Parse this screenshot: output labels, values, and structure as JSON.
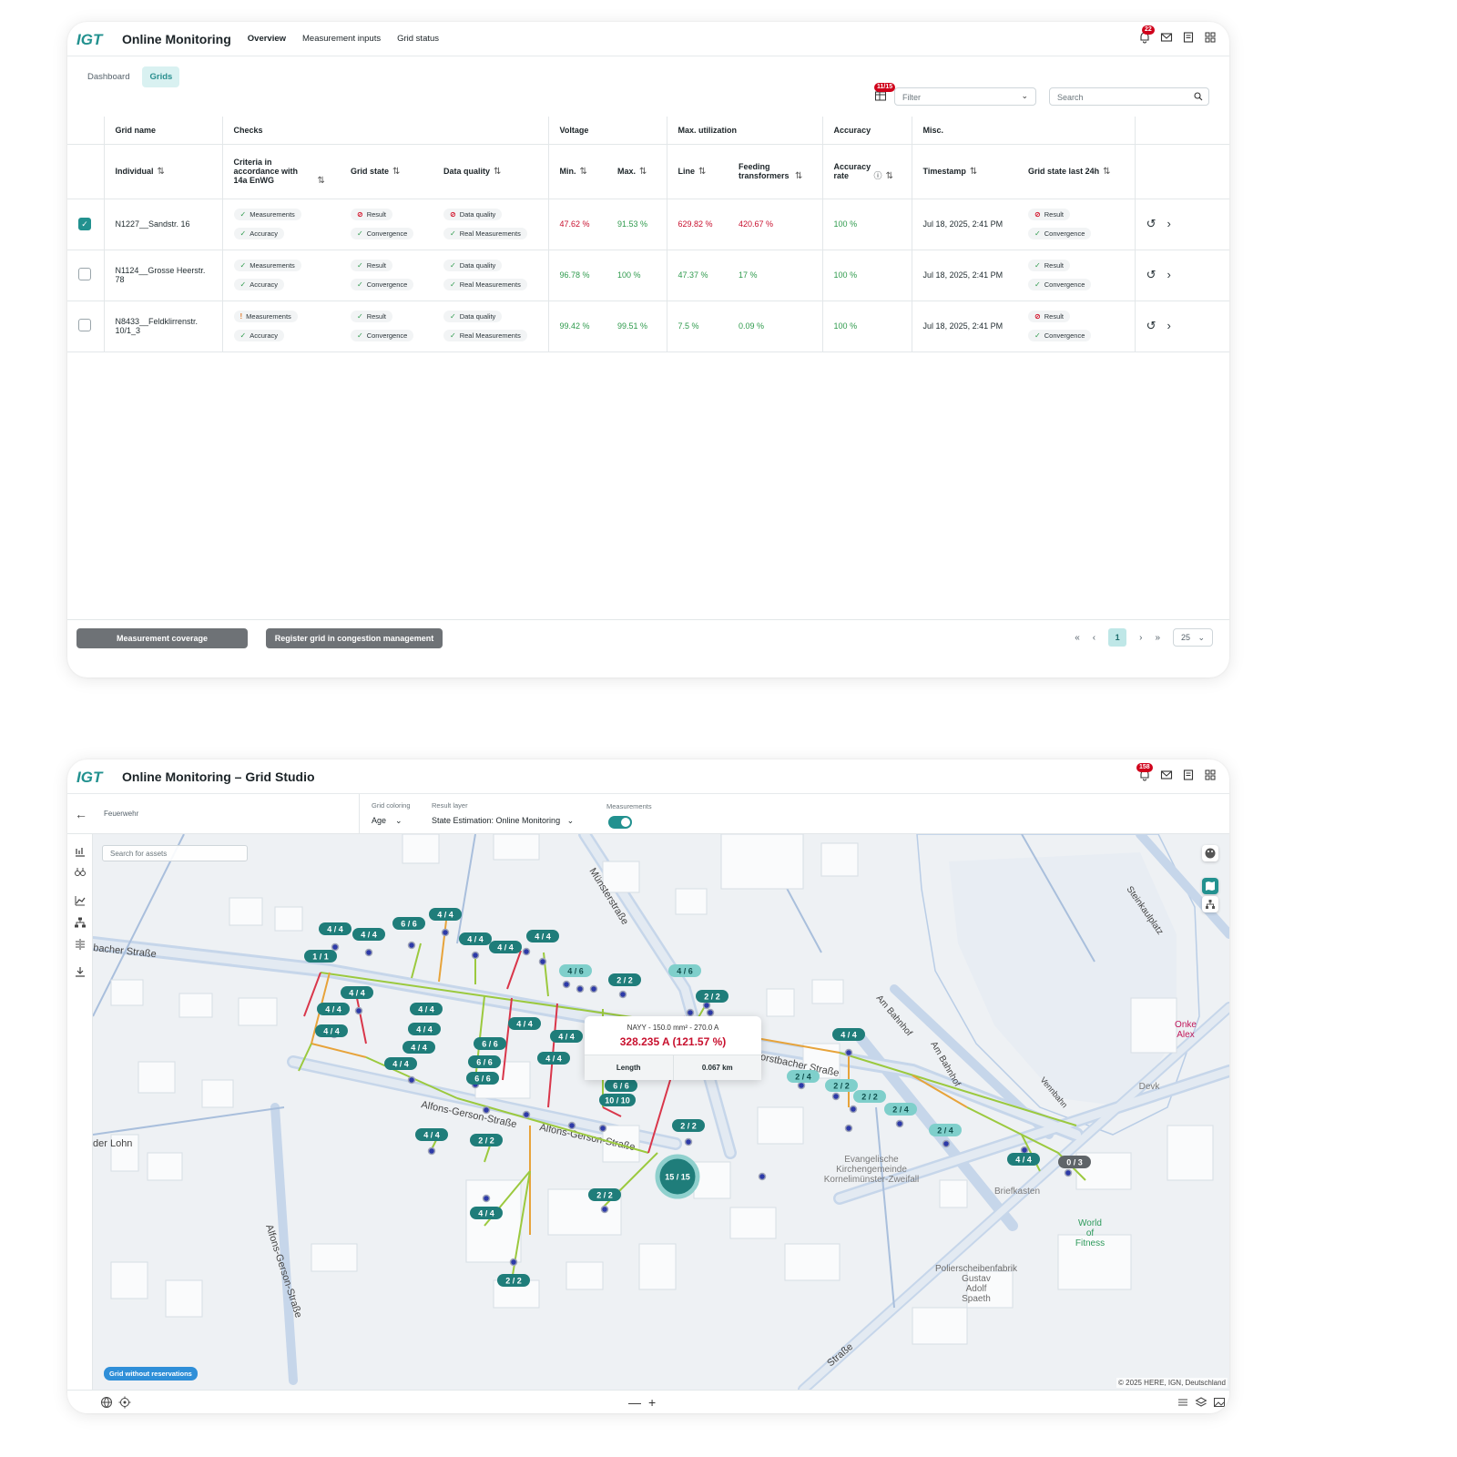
{
  "brand": {
    "accent": "#22918f",
    "alert": "#d0021b",
    "ok": "#2e9a4c",
    "logo_text": "IGT"
  },
  "screen1": {
    "app_title": "Online Monitoring",
    "nav": [
      "Overview",
      "Measurement inputs",
      "Grid status"
    ],
    "notification_count": "22",
    "tabs": [
      "Dashboard",
      "Grids"
    ],
    "column_selector_count": "11/15",
    "filter_placeholder": "Filter",
    "search_placeholder": "Search",
    "groups": [
      "Grid name",
      "Checks",
      "Voltage",
      "Max. utilization",
      "Accuracy",
      "Misc."
    ],
    "columns": {
      "individual": "Individual",
      "criteria": "Criteria in accordance with 14a EnWG",
      "grid_state": "Grid state",
      "data_quality": "Data quality",
      "min": "Min.",
      "max": "Max.",
      "line": "Line",
      "feeding": "Feeding transformers",
      "accuracy_rate": "Accuracy rate",
      "timestamp": "Timestamp",
      "grid_state_24h": "Grid state last 24h"
    },
    "rows": [
      {
        "checked": true,
        "name": "N1227__Sandstr. 16",
        "c1": "Measurements",
        "c1s": "ok",
        "c2": "Accuracy",
        "c2s": "ok",
        "g1": "Result",
        "g1s": "bad",
        "g2": "Convergence",
        "g2s": "ok",
        "d1": "Data quality",
        "d1s": "bad",
        "d2": "Real Measurements",
        "d2s": "ok",
        "min": "47.62 %",
        "max": "91.53 %",
        "line": "629.82 %",
        "feed": "420.67 %",
        "acc": "100 %",
        "ts": "Jul 18, 2025, 2:41 PM",
        "h1": "Result",
        "h1s": "bad",
        "h2": "Convergence",
        "h2s": "ok"
      },
      {
        "checked": false,
        "name": "N1124__Grosse Heerstr. 78",
        "c1": "Measurements",
        "c1s": "ok",
        "c2": "Accuracy",
        "c2s": "ok",
        "g1": "Result",
        "g1s": "ok",
        "g2": "Convergence",
        "g2s": "ok",
        "d1": "Data quality",
        "d1s": "ok",
        "d2": "Real Measurements",
        "d2s": "ok",
        "min": "96.78 %",
        "max": "100 %",
        "line": "47.37 %",
        "feed": "17 %",
        "acc": "100 %",
        "ts": "Jul 18, 2025, 2:41 PM",
        "h1": "Result",
        "h1s": "ok",
        "h2": "Convergence",
        "h2s": "ok"
      },
      {
        "checked": false,
        "name": "N8433__Feldklirrenstr. 10/1_3",
        "c1": "Measurements",
        "c1s": "warn",
        "c2": "Accuracy",
        "c2s": "ok",
        "g1": "Result",
        "g1s": "ok",
        "g2": "Convergence",
        "g2s": "ok",
        "d1": "Data quality",
        "d1s": "ok",
        "d2": "Real Measurements",
        "d2s": "ok",
        "min": "99.42 %",
        "max": "99.51 %",
        "line": "7.5 %",
        "feed": "0.09 %",
        "acc": "100 %",
        "ts": "Jul 18, 2025, 2:41 PM",
        "h1": "Result",
        "h1s": "bad",
        "h2": "Convergence",
        "h2s": "ok"
      }
    ],
    "buttons": {
      "coverage": "Measurement coverage",
      "register": "Register grid in congestion management"
    },
    "pager": {
      "first": "«",
      "prev": "‹",
      "page": "1",
      "next": "›",
      "last": "»",
      "size": "25"
    }
  },
  "screen2": {
    "app_title": "Online Monitoring – Grid Studio",
    "notification_count": "158",
    "breadcrumb": "Feuerwehr",
    "grid_coloring_label": "Grid coloring",
    "grid_coloring_value": "Age",
    "result_layer_label": "Result layer",
    "result_layer_value": "State Estimation: Online Monitoring",
    "measurements_label": "Measurements",
    "measurements_on": true,
    "asset_search_placeholder": "Search for assets",
    "tooltip": {
      "cable": "NAYY - 150.0 mm² - 270.0 A",
      "value": "328.235 A (121.57 %)",
      "length_label": "Length",
      "length_value": "0.067 km"
    },
    "legend_chip": "Grid without reservations",
    "copyright": "© 2025 HERE, IGN, Deutschland",
    "streets": [
      "bacher Straße",
      "Münsterstraße",
      "Alfons-Gerson-Straße",
      "Alfons-Gerson-Straße",
      "Alfons-Gerson-Straße",
      "Am Bahnhof",
      "Am Bahnhof",
      "Steinkaulplatz",
      "erforstbacher Straße",
      "der Lohn",
      "Vennbahn",
      "Straße"
    ],
    "pois": [
      "Evangelische Kirchengemeinde Kornelimünster-Zweifall",
      "Briefkasten",
      "World of Fitness",
      "Polierscheibenfabrik Gustav Adolf Spaeth",
      "Devk",
      "Onke Alex"
    ],
    "clusters": [
      {
        "label": "4 / 4"
      },
      {
        "label": "4 / 4"
      },
      {
        "label": "1 / 1"
      },
      {
        "label": "6 / 6"
      },
      {
        "label": "4 / 4"
      },
      {
        "label": "4 / 4"
      },
      {
        "label": "4 / 4"
      },
      {
        "label": "4 / 4"
      },
      {
        "label": "4 / 6"
      },
      {
        "label": "2 / 2"
      },
      {
        "label": "4 / 6"
      },
      {
        "label": "2 / 2"
      },
      {
        "label": "4 / 4"
      },
      {
        "label": "4 / 4"
      },
      {
        "label": "4 / 4"
      },
      {
        "label": "4 / 4"
      },
      {
        "label": "4 / 4"
      },
      {
        "label": "4 / 4"
      },
      {
        "label": "4 / 4"
      },
      {
        "label": "6 / 6"
      },
      {
        "label": "6 / 6"
      },
      {
        "label": "6 / 6"
      },
      {
        "label": "4 / 4"
      },
      {
        "label": "4 / 4"
      },
      {
        "label": "4 / 4"
      },
      {
        "label": "6 / 6"
      },
      {
        "label": "10 / 10"
      },
      {
        "label": "4 / 4"
      },
      {
        "label": "2 / 2"
      },
      {
        "label": "2 / 2"
      },
      {
        "label": "15 / 15"
      },
      {
        "label": "2 / 2"
      },
      {
        "label": "4 / 4"
      },
      {
        "label": "2 / 2"
      },
      {
        "label": "4 / 4"
      },
      {
        "label": "2 / 4"
      },
      {
        "label": "2 / 2"
      },
      {
        "label": "2 / 2"
      },
      {
        "label": "2 / 4"
      },
      {
        "label": "2 / 4"
      },
      {
        "label": "4 / 4"
      },
      {
        "label": "0 / 3"
      }
    ]
  }
}
